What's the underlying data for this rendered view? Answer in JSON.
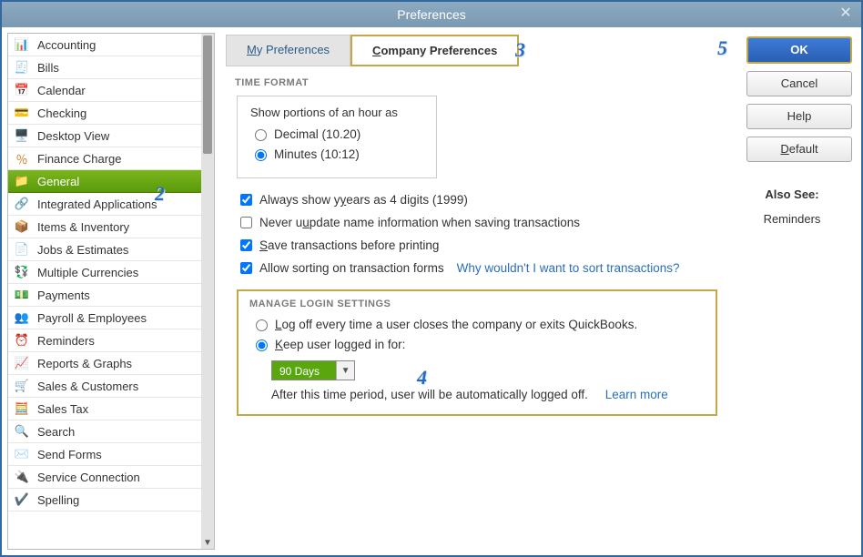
{
  "window": {
    "title": "Preferences"
  },
  "sidebar": {
    "items": [
      {
        "label": "Accounting",
        "icon": "📊",
        "color": "#d99a2b"
      },
      {
        "label": "Bills",
        "icon": "🧾",
        "color": "#3d9ad6"
      },
      {
        "label": "Calendar",
        "icon": "📅",
        "color": "#6a7ab2"
      },
      {
        "label": "Checking",
        "icon": "💳",
        "color": "#3d9ad6"
      },
      {
        "label": "Desktop View",
        "icon": "🖥️",
        "color": "#888"
      },
      {
        "label": "Finance Charge",
        "icon": "％",
        "color": "#d07a1d"
      },
      {
        "label": "General",
        "icon": "📁",
        "color": "#e6c66a",
        "selected": true
      },
      {
        "label": "Integrated Applications",
        "icon": "🔗",
        "color": "#4a9a4a"
      },
      {
        "label": "Items & Inventory",
        "icon": "📦",
        "color": "#d99a2b"
      },
      {
        "label": "Jobs & Estimates",
        "icon": "📄",
        "color": "#d99a2b"
      },
      {
        "label": "Multiple Currencies",
        "icon": "💱",
        "color": "#3d9ad6"
      },
      {
        "label": "Payments",
        "icon": "💵",
        "color": "#4a9a4a"
      },
      {
        "label": "Payroll & Employees",
        "icon": "👥",
        "color": "#4a9a4a"
      },
      {
        "label": "Reminders",
        "icon": "⏰",
        "color": "#d99a2b"
      },
      {
        "label": "Reports & Graphs",
        "icon": "📈",
        "color": "#4a9a4a"
      },
      {
        "label": "Sales & Customers",
        "icon": "🛒",
        "color": "#888"
      },
      {
        "label": "Sales Tax",
        "icon": "🧮",
        "color": "#888"
      },
      {
        "label": "Search",
        "icon": "🔍",
        "color": "#888"
      },
      {
        "label": "Send Forms",
        "icon": "✉️",
        "color": "#3d9ad6"
      },
      {
        "label": "Service Connection",
        "icon": "🔌",
        "color": "#888"
      },
      {
        "label": "Spelling",
        "icon": "✔️",
        "color": "#4a9a4a"
      }
    ]
  },
  "tabs": {
    "my": "y Preferences",
    "my_prefix": "M",
    "company": "ompany Preferences",
    "company_prefix": "C"
  },
  "time_format": {
    "title": "TIME FORMAT",
    "prompt": "Show portions of an hour as",
    "decimal": "Decimal (10.20)",
    "minutes": "Minutes (10:12)"
  },
  "checks": {
    "years": "ears as 4 digits (1999)",
    "years_prefix": "Always show y",
    "never_update": "pdate name information when saving transactions",
    "never_update_prefix": "Never u",
    "save_prefix": "S",
    "save": "ave transactions before printing",
    "allow_sort": "Allow sorting on transaction forms",
    "sort_link": "Why wouldn't I want to sort transactions?"
  },
  "login": {
    "title": "MANAGE LOGIN SETTINGS",
    "logoff_prefix": "L",
    "logoff": "og off every time a user closes the company or exits QuickBooks.",
    "keep_prefix": "K",
    "keep": "eep user logged in for:",
    "duration": "90 Days",
    "after": "After this time period, user will be automatically logged off.",
    "learn": "Learn more"
  },
  "buttons": {
    "ok": "OK",
    "cancel": "Cancel",
    "help": "Help",
    "default_prefix": "D",
    "default": "efault"
  },
  "also_see": {
    "title": "Also See:",
    "item": "Reminders"
  },
  "callouts": {
    "c2": "2",
    "c3": "3",
    "c4": "4",
    "c5": "5"
  }
}
